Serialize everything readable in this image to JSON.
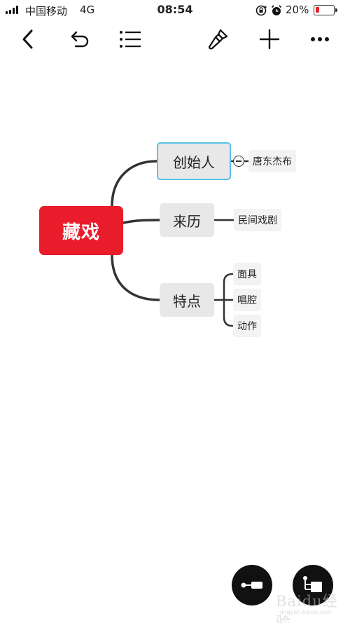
{
  "status_bar": {
    "carrier": "中国移动",
    "network": "4G",
    "time": "08:54",
    "battery_percent": "20%",
    "battery_level": 0.2,
    "battery_color": "#e6232c",
    "icons": [
      "signal-icon",
      "rotation-lock-icon",
      "alarm-icon",
      "battery-icon"
    ]
  },
  "toolbar": {
    "buttons": [
      "back-icon",
      "undo-icon",
      "outline-list-icon",
      "style-brush-icon",
      "add-icon",
      "more-icon"
    ]
  },
  "mindmap": {
    "central": {
      "label": "藏戏",
      "color": "#e81c2a"
    },
    "branches": [
      {
        "label": "创始人",
        "selected": true,
        "children": [
          "唐东杰布"
        ]
      },
      {
        "label": "来历",
        "selected": false,
        "children": [
          "民间戏剧"
        ]
      },
      {
        "label": "特点",
        "selected": false,
        "children": [
          "面具",
          "唱腔",
          "动作"
        ]
      }
    ],
    "selection_color": "#59c3e6"
  },
  "fabs": [
    "node-insert-icon",
    "layout-structure-icon"
  ],
  "watermark": {
    "text": "Baidu经验",
    "url": "jingyan.baidu.com"
  }
}
